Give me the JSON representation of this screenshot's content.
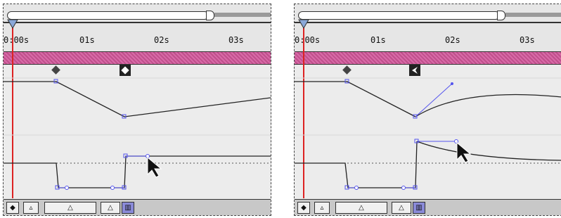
{
  "ruler": {
    "labels": [
      "0:00s",
      "01s",
      "02s",
      "03s"
    ]
  },
  "icons": {
    "nav_toggle": "◆",
    "zoom_small": "▵",
    "zoom_slider": "△",
    "zoom_large": "△",
    "graph_toggle": "▥"
  },
  "colors": {
    "accent": "#5555ee",
    "playhead": "#dd2222",
    "layer_bar": "#d86aa8"
  }
}
